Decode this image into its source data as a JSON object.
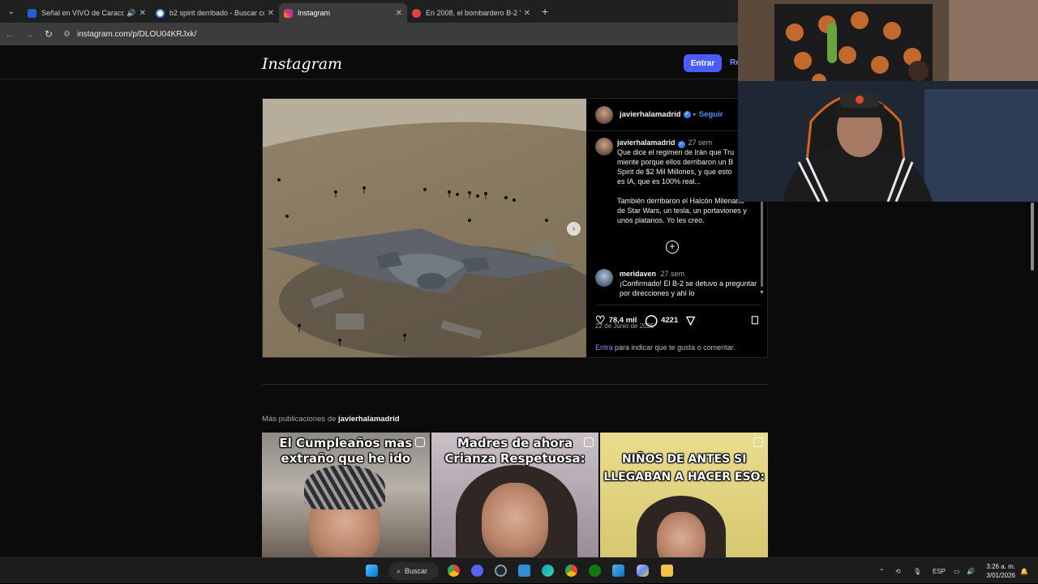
{
  "browser": {
    "tabs": [
      {
        "title": "Señal en VIVO de Caracol T",
        "color": "#2a5bd7",
        "audio": true
      },
      {
        "title": "b2 spirit derribado - Buscar co",
        "color": "#4285f4",
        "audio": false
      },
      {
        "title": "Instagram",
        "color": "#e1306c",
        "audio": false,
        "active": true
      },
      {
        "title": "En 2008, el bombardero B-2 \"S",
        "color": "#e0443a",
        "audio": false
      }
    ],
    "url": "instagram.com/p/DLOU04KRJxk/"
  },
  "instagram": {
    "logo": "Instagram",
    "login_button": "Entrar",
    "register_link": "Re",
    "post": {
      "author": "javierhalamadrid",
      "follow": "Seguir",
      "caption_author": "javierhalamadrid",
      "caption_time": "27 sem",
      "caption": "Que dice el regimen de Irán que Tru\nmiente porque ellos derribaron un B\nSpirit de $2 Mil Millones, y que esto\nes IA, que es 100% real...\n\nTambién derribaron el Halcón Milenario\nde Star Wars, un tesla, un portaviones y\nunos platanos. Yo les creo.",
      "comment_author": "meridaven",
      "comment_time": "27 sem",
      "comment": "¡Confirmado! El B-2 se detuvo a preguntar por direcciones y ahí lo",
      "likes": "78,4 mil",
      "comments_count": "4221",
      "date": "22 de Junio de 2025",
      "login_link": "Entra",
      "login_prompt": "para indicar que te gusta o comentar."
    },
    "more_label": "Más publicaciones de",
    "more_author": "javierhalamadrid",
    "thumbnails": [
      {
        "caption": "El Cumpleaños mas extraño que he ido"
      },
      {
        "caption": "Madres de ahora Crianza Respetuosa:"
      },
      {
        "caption": "NIÑOS DE ANTES SI LLEGABAN A HACER ESO:"
      }
    ]
  },
  "taskbar": {
    "search": "Buscar",
    "lang": "ESP",
    "time": "3:26 a. m.",
    "date": "3/01/2026"
  }
}
